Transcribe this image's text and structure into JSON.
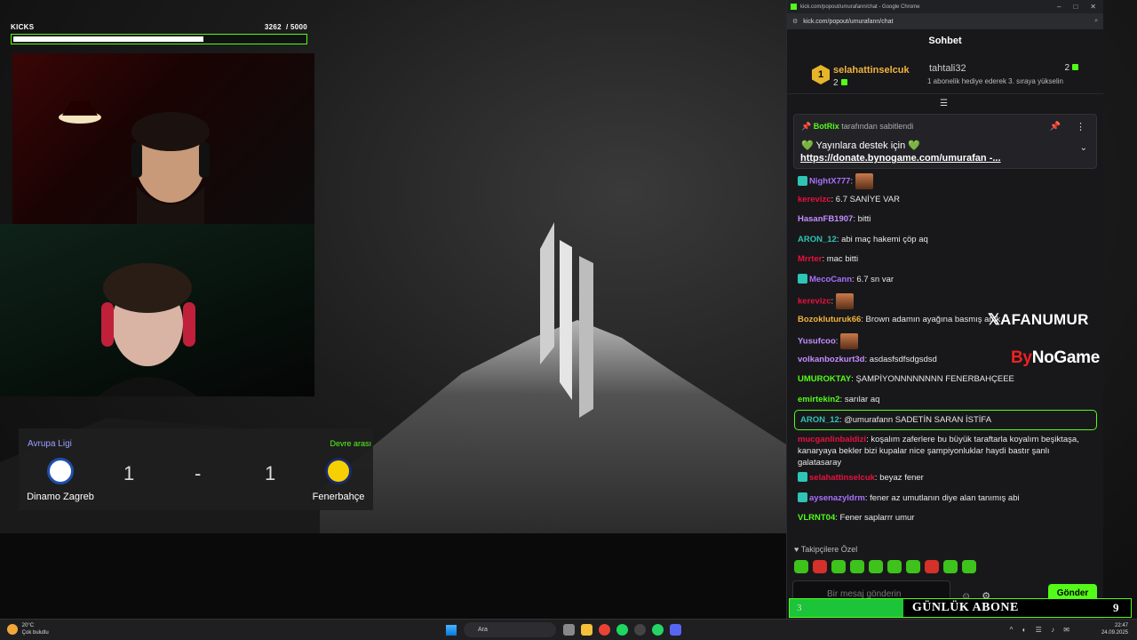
{
  "kicks": {
    "label": "KICKS",
    "current": "3262",
    "goal": "/ 5000",
    "progress": 0.6524
  },
  "score": {
    "league": "Avrupa Ligi",
    "status": "Devre arası",
    "home_team": "Dinamo Zagreb",
    "away_team": "Fenerbahçe",
    "home_goals": "1",
    "separator": "-",
    "away_goals": "1"
  },
  "browser": {
    "title": "kick.com/popout/umurafann/chat - Google Chrome",
    "url": "kick.com/popout/umurafann/chat"
  },
  "chat": {
    "header": "Sohbet",
    "leaderboard": {
      "first": {
        "rank": "1",
        "name": "selahattinselcuk",
        "count": "2"
      },
      "second": {
        "name": "tahtali32",
        "count": "2",
        "hint": "1 abonelik hediye ederek 3. sıraya yükselin"
      }
    },
    "pinned": {
      "user": "BotRix",
      "pinned_by_suffix": "tarafından sabitlendi",
      "line1": "💚 Yayınlara destek için 💚",
      "link": "https://donate.bynogame.com/umurafan",
      "link_suffix": "-..."
    },
    "messages": [
      {
        "user": "NightX777",
        "color": "#a970ff",
        "text": "",
        "emote": true,
        "badge": true
      },
      {
        "user": "kerevizc",
        "color": "#e9113c",
        "text": "6.7 SANİYE VAR"
      },
      {
        "user": "HasanFB1907",
        "color": "#c58cff",
        "text": "bitti"
      },
      {
        "user": "ARON_12",
        "color": "#2ec4b6",
        "text": "abi maç hakemi çöp aq"
      },
      {
        "user": "Mrrter",
        "color": "#e9113c",
        "text": "mac bitti"
      },
      {
        "user": "MecoCann",
        "color": "#a970ff",
        "text": "6.7 sn var",
        "badge": true
      },
      {
        "user": "kerevizc",
        "color": "#e9113c",
        "text": "",
        "emote": true
      },
      {
        "user": "Bozokluturuk66",
        "color": "#f2b33b",
        "text": "Brown adamın ayağına basmış amk"
      },
      {
        "user": "Yusufcoo",
        "color": "#c58cff",
        "text": "",
        "emote": true
      },
      {
        "user": "volkanbozkurt3d",
        "color": "#c58cff",
        "text": "asdasfsdfsdgsdsd"
      },
      {
        "user": "UMUROKTAY",
        "color": "#53fc18",
        "text": "ŞAMPİYONNNNNNNN FENERBAHÇEEE"
      },
      {
        "user": "emirtekin2",
        "color": "#53fc18",
        "text": "sarılar aq"
      },
      {
        "user": "ARON_12",
        "color": "#2ec4b6",
        "text": "@umurafann SADETİN SARAN İSTİFA",
        "highlight": true
      },
      {
        "user": "mucganlinbaldizi",
        "color": "#e9113c",
        "text": "koşalım zaferlere bu büyük taraftarla koyalım beşiktaşa, kanaryaya bekler bizi kupalar nice şampiyonluklar haydi bastır şanlı galatasaray"
      },
      {
        "user": "selahattinselcuk",
        "color": "#e9113c",
        "text": "beyaz fener",
        "badge": true
      },
      {
        "user": "aysenazyldrm",
        "color": "#a970ff",
        "text": "fener az umutlanın diye alan tanımış abi",
        "badge": true
      },
      {
        "user": "VLRNT04",
        "color": "#53fc18",
        "text": "Fener saplarrr umur"
      }
    ],
    "followers_label": "Takipçilere Özel",
    "input_placeholder": "Bir mesaj gönderin",
    "send_label": "Gönder"
  },
  "overlay": {
    "social_handle": "AFANUMUR",
    "brand_prefix": "By",
    "brand_name": "NoGame",
    "sub_current": "3",
    "sub_label": "GÜNLÜK ABONE",
    "sub_goal": "9",
    "sub_progress": 0.333
  },
  "taskbar": {
    "weather_temp": "20°C",
    "weather_desc": "Çok bulutlu",
    "search_placeholder": "Ara",
    "time": "22:47",
    "date": "24.09.2025"
  },
  "colors": {
    "kick_green": "#53fc18",
    "gold": "#f2b33b"
  }
}
